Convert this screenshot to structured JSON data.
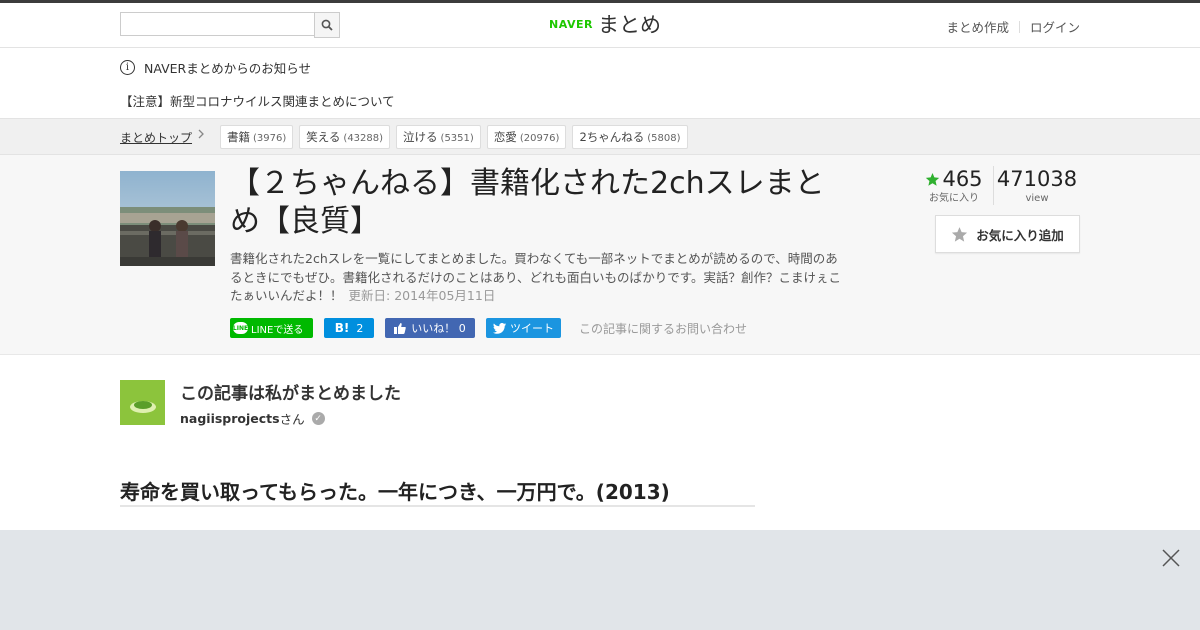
{
  "header": {
    "search": {
      "value": "",
      "placeholder": ""
    },
    "logo_brand": "NAVER",
    "logo_text": "まとめ",
    "links": {
      "create": "まとめ作成",
      "login": "ログイン"
    }
  },
  "notice": {
    "title": "NAVERまとめからのお知らせ",
    "link": "【注意】新型コロナウイルス関連まとめについて"
  },
  "breadcrumb": {
    "home": "まとめトップ",
    "tags": [
      {
        "name": "書籍",
        "count": "(3976)"
      },
      {
        "name": "笑える",
        "count": "(43288)"
      },
      {
        "name": "泣ける",
        "count": "(5351)"
      },
      {
        "name": "恋愛",
        "count": "(20976)"
      },
      {
        "name": "2ちゃんねる",
        "count": "(5808)"
      }
    ]
  },
  "article": {
    "title": "【２ちゃんねる】書籍化された2chスレまとめ【良質】",
    "description": "書籍化された2chスレを一覧にしてまとめました。買わなくても一部ネットでまとめが読めるので、時間のあるときにでもぜひ。書籍化されるだけのことはあり、どれも面白いものばかりです。実話？創作？こまけぇこたぁいいんだよ！！",
    "updated": "更新日: 2014年05月11日",
    "share": {
      "line": "LINEで送る",
      "hatena_count": "2",
      "facebook": "いいね！ 0",
      "twitter": "ツイート"
    },
    "contact": "この記事に関するお問い合わせ",
    "stats": {
      "favorites": "465",
      "favorites_label": "お気に入り",
      "views": "471038",
      "views_label": "view"
    },
    "fav_button": "お気に入り追加"
  },
  "author": {
    "heading": "この記事は私がまとめました",
    "name": "nagiisprojects",
    "suffix": "さん"
  },
  "section": {
    "heading": "寿命を買い取ってもらった。一年につき、一万円で。(2013)"
  },
  "colors": {
    "naver_green": "#1ec800",
    "line_green": "#00b900",
    "hatena_blue": "#008fde",
    "facebook_blue": "#4267b2",
    "twitter_blue": "#1b95e0",
    "star_green": "#2fb02f",
    "overlay_gray": "#e1e5e9"
  },
  "icons": {
    "search": "magnifier-icon",
    "info": "info-circle-icon",
    "chevron": "chevron-right-icon",
    "star": "star-icon",
    "close": "close-x-icon",
    "verified": "check-badge-icon"
  }
}
